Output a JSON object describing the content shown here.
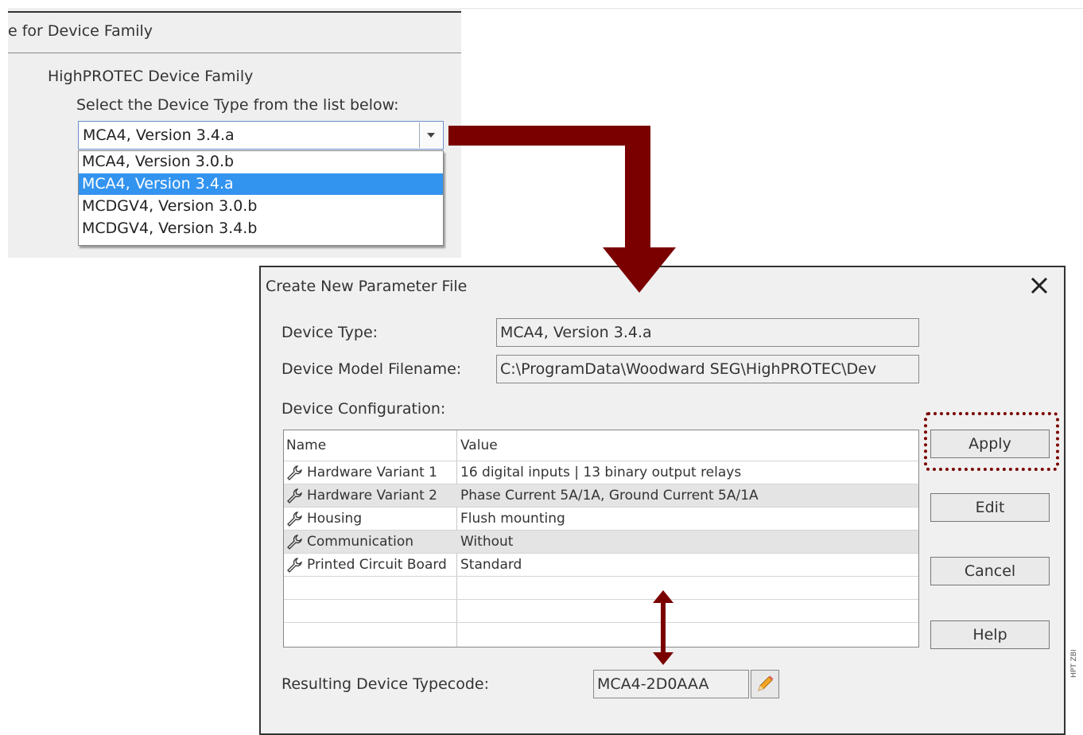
{
  "family_panel": {
    "header": "e for Device Family",
    "family_label": "HighPROTEC Device Family",
    "select_label": "Select the Device Type from the list below:",
    "combo_value": "MCA4, Version 3.4.a",
    "dropdown_items": [
      "MCA4, Version 3.0.b",
      "MCA4, Version 3.4.a",
      "MCDGV4, Version 3.0.b",
      "MCDGV4, Version 3.4.b"
    ],
    "selected_index": 1
  },
  "dialog": {
    "title": "Create New Parameter File",
    "device_type_label": "Device Type:",
    "device_type_value": "MCA4, Version 3.4.a",
    "model_filename_label": "Device Model Filename:",
    "model_filename_value": "C:\\ProgramData\\Woodward SEG\\HighPROTEC\\Dev",
    "config_label": "Device Configuration:",
    "table": {
      "headers": [
        "Name",
        "Value"
      ],
      "rows": [
        {
          "name": "Hardware Variant 1",
          "value": "16 digital inputs | 13 binary output relays"
        },
        {
          "name": "Hardware Variant 2",
          "value": "Phase Current 5A/1A, Ground Current 5A/1A"
        },
        {
          "name": "Housing",
          "value": "Flush mounting"
        },
        {
          "name": "Communication",
          "value": "Without"
        },
        {
          "name": "Printed Circuit Board",
          "value": "Standard"
        }
      ]
    },
    "buttons": {
      "apply": "Apply",
      "edit": "Edit",
      "cancel": "Cancel",
      "help": "Help"
    },
    "typecode_label": "Resulting Device Typecode:",
    "typecode_value": "MCA4-2D0AAA"
  },
  "side_tag": "HPT ZBI",
  "colors": {
    "arrow": "#7a0000",
    "selection": "#3394f0"
  }
}
